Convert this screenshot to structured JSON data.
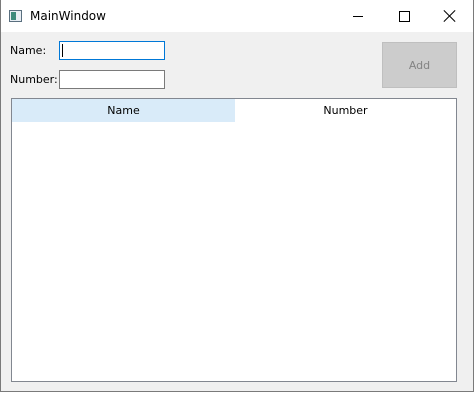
{
  "window": {
    "title": "MainWindow",
    "icon": "app-window-icon",
    "controls": [
      "minimize-icon",
      "maximize-icon",
      "close-icon"
    ]
  },
  "form": {
    "name_label": "Name:",
    "name_value": "",
    "number_label": "Number:",
    "number_value": ""
  },
  "add_button": {
    "label": "Add",
    "enabled": false
  },
  "table": {
    "columns": [
      "Name",
      "Number"
    ],
    "rows": []
  },
  "colors": {
    "focus_border": "#0078d7",
    "header_selected": "#d9ebf9",
    "disabled_button": "#cccccc"
  }
}
